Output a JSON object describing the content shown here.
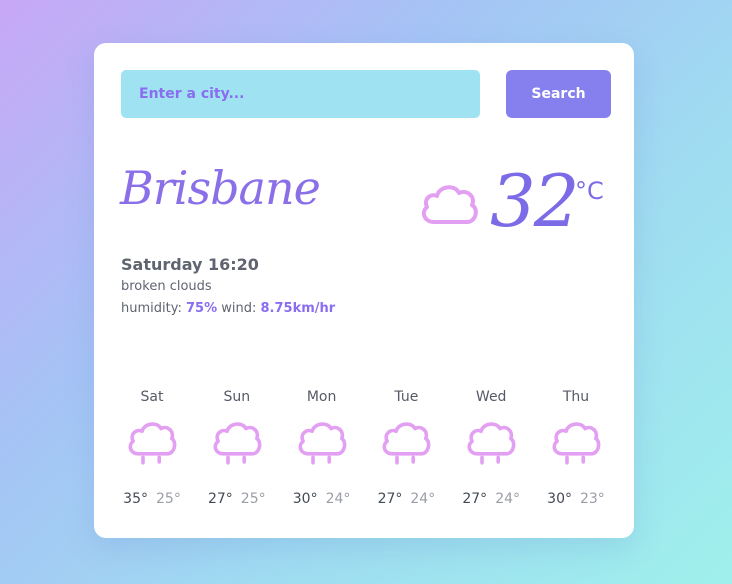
{
  "search": {
    "placeholder": "Enter a city...",
    "button_label": "Search"
  },
  "current": {
    "city": "Brisbane",
    "temperature": "32",
    "unit": "°C",
    "date_time": "Saturday 16:20",
    "description": "broken clouds",
    "humidity_label": "humidity:",
    "humidity_value": "75%",
    "wind_label": "wind:",
    "wind_value": "8.75km/hr",
    "icon": "cloud-icon"
  },
  "forecast": [
    {
      "day": "Sat",
      "max": "35°",
      "min": "25°",
      "icon": "rain-cloud-icon"
    },
    {
      "day": "Sun",
      "max": "27°",
      "min": "25°",
      "icon": "rain-cloud-icon"
    },
    {
      "day": "Mon",
      "max": "30°",
      "min": "24°",
      "icon": "rain-cloud-icon"
    },
    {
      "day": "Tue",
      "max": "27°",
      "min": "24°",
      "icon": "rain-cloud-icon"
    },
    {
      "day": "Wed",
      "max": "27°",
      "min": "24°",
      "icon": "rain-cloud-icon"
    },
    {
      "day": "Thu",
      "max": "30°",
      "min": "23°",
      "icon": "rain-cloud-icon"
    }
  ],
  "colors": {
    "accent": "#8680ee",
    "input_background": "#9fe2f2",
    "icon_stroke": "#e3a0f2"
  }
}
